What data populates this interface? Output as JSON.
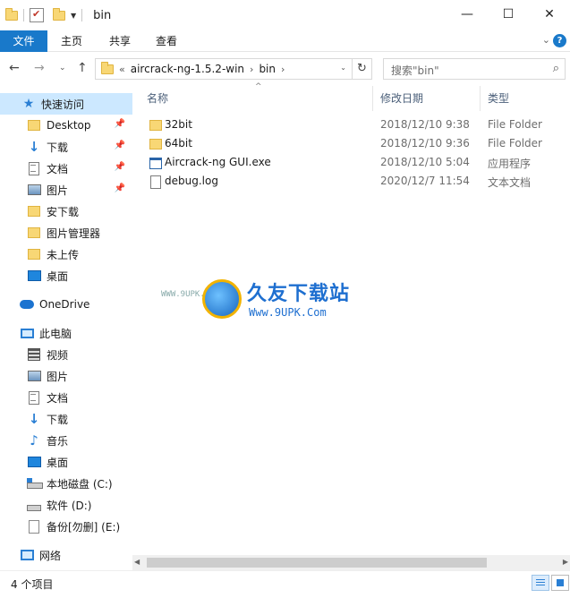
{
  "window": {
    "title": "bin",
    "minimize": "—",
    "maximize": "☐",
    "close": "✕"
  },
  "ribbon": {
    "file": "文件",
    "home": "主页",
    "share": "共享",
    "view": "查看",
    "help": "?"
  },
  "address": {
    "prefix": "«",
    "crumbs": [
      "aircrack-ng-1.5.2-win",
      "bin"
    ],
    "search_placeholder": "搜索\"bin\""
  },
  "nav": {
    "quick_access": "快速访问",
    "quick_items": [
      {
        "label": "Desktop",
        "icon": "folder-icon",
        "pinned": true
      },
      {
        "label": "下载",
        "icon": "download-icon",
        "pinned": true
      },
      {
        "label": "文档",
        "icon": "document-icon",
        "pinned": true
      },
      {
        "label": "图片",
        "icon": "picture-icon",
        "pinned": true
      },
      {
        "label": "安下载",
        "icon": "folder-icon",
        "pinned": false
      },
      {
        "label": "图片管理器",
        "icon": "folder-icon",
        "pinned": false
      },
      {
        "label": "未上传",
        "icon": "folder-icon",
        "pinned": false
      },
      {
        "label": "桌面",
        "icon": "desktop-icon",
        "pinned": false
      }
    ],
    "onedrive": "OneDrive",
    "this_pc": "此电脑",
    "pc_items": [
      {
        "label": "视频",
        "icon": "video-icon"
      },
      {
        "label": "图片",
        "icon": "picture-icon"
      },
      {
        "label": "文档",
        "icon": "document-icon"
      },
      {
        "label": "下载",
        "icon": "download-icon"
      },
      {
        "label": "音乐",
        "icon": "music-icon"
      },
      {
        "label": "桌面",
        "icon": "desktop-icon"
      },
      {
        "label": "本地磁盘 (C:)",
        "icon": "drive-c-icon"
      },
      {
        "label": "软件 (D:)",
        "icon": "drive-icon"
      },
      {
        "label": "备份[勿删] (E:)",
        "icon": "drive-blank-icon"
      }
    ],
    "network": "网络"
  },
  "columns": {
    "name": "名称",
    "date": "修改日期",
    "type": "类型"
  },
  "files": [
    {
      "name": "32bit",
      "date": "2018/12/10 9:38",
      "type": "File Folder",
      "icon": "folder-icon"
    },
    {
      "name": "64bit",
      "date": "2018/12/10 9:36",
      "type": "File Folder",
      "icon": "folder-icon"
    },
    {
      "name": "Aircrack-ng GUI.exe",
      "date": "2018/12/10 5:04",
      "type": "应用程序",
      "icon": "exe-icon"
    },
    {
      "name": "debug.log",
      "date": "2020/12/7 11:54",
      "type": "文本文档",
      "icon": "text-file-icon"
    }
  ],
  "watermark": {
    "small": "WWW.9UPK.COM",
    "brand": "久友下载站",
    "url": "Www.9UPK.Com"
  },
  "status": {
    "count": "4 个项目"
  }
}
